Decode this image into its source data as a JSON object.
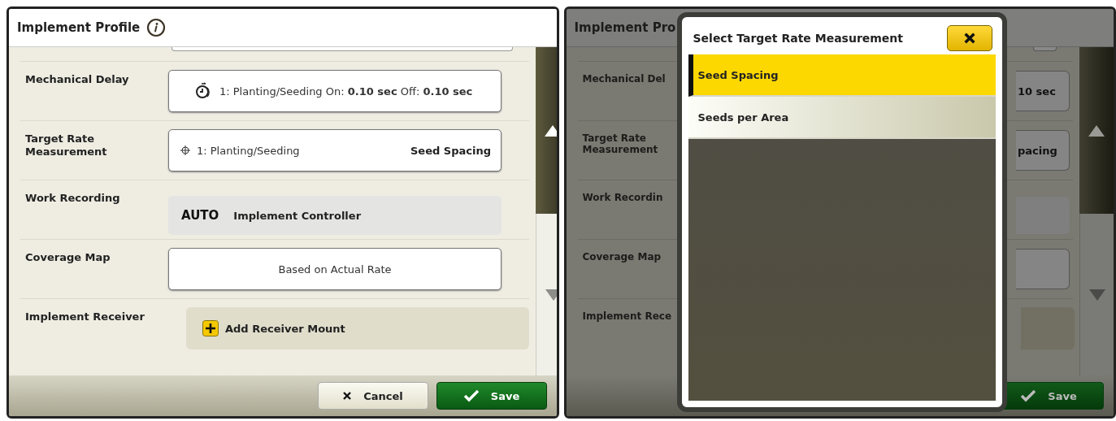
{
  "profile_screen": {
    "title": "Implement Profile",
    "rows": [
      {
        "label": "Mechanical Delay",
        "kind": "delay",
        "value": "1: Planting/Seeding On: **0.10 sec** Off: **0.10 sec**"
      },
      {
        "label": "Target Rate Measurement",
        "kind": "select",
        "value": "1: Planting/Seeding",
        "choice": "Seed Spacing"
      },
      {
        "label": "Work Recording",
        "kind": "auto",
        "badge": "AUTO",
        "value": "Implement Controller"
      },
      {
        "label": "Coverage Map",
        "kind": "button",
        "value": "Based on Actual Rate"
      },
      {
        "label": "Implement Receiver",
        "kind": "add",
        "value": "Add Receiver Mount"
      }
    ],
    "cancel": "Cancel",
    "save": "Save"
  },
  "dialog_screen": {
    "background": {
      "title": "Implement Pro",
      "rows": [
        {
          "label": "Mechanical Del",
          "kind": "box",
          "value": "10 sec"
        },
        {
          "label": "Target Rate Measurement",
          "kind": "box",
          "value": "pacing"
        },
        {
          "label": "Work Recordin",
          "kind": "flat"
        },
        {
          "label": "Coverage Map",
          "kind": "box"
        },
        {
          "label": "Implement Rece",
          "kind": "panel"
        }
      ],
      "save": "Save"
    },
    "dialog": {
      "title": "Select Target Rate Measurement",
      "options": [
        {
          "label": "Seed Spacing",
          "selected": true
        },
        {
          "label": "Seeds per Area",
          "selected": false
        }
      ]
    }
  }
}
